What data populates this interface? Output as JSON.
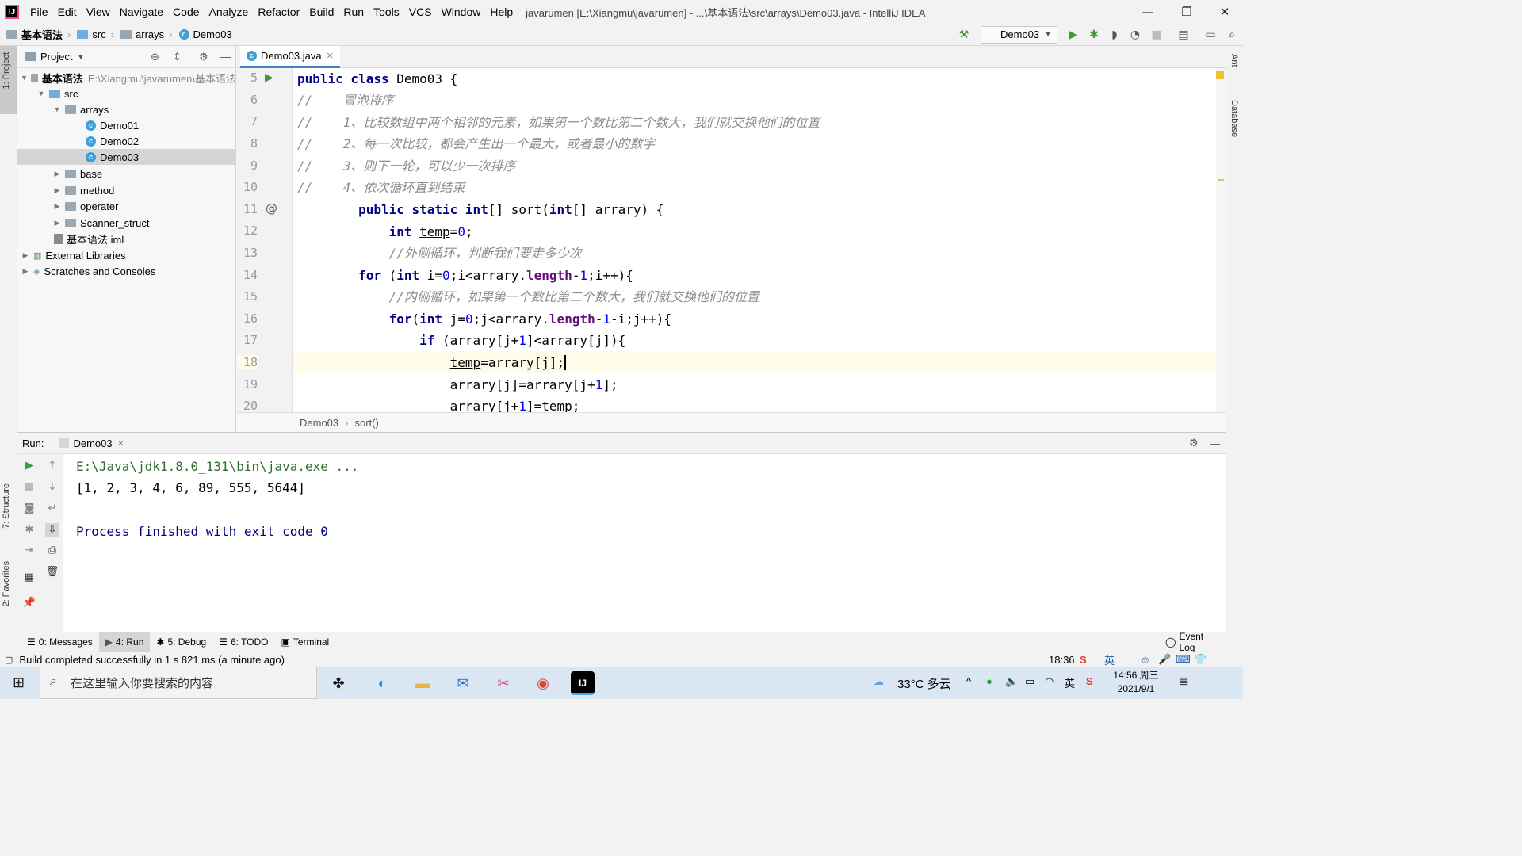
{
  "app": {
    "logo_text": "IJ",
    "menu": [
      "File",
      "Edit",
      "View",
      "Navigate",
      "Code",
      "Analyze",
      "Refactor",
      "Build",
      "Run",
      "Tools",
      "VCS",
      "Window",
      "Help"
    ],
    "window_title": "javarumen [E:\\Xiangmu\\javarumen] - ...\\基本语法\\src\\arrays\\Demo03.java - IntelliJ IDEA"
  },
  "nav": {
    "crumbs": [
      "基本语法",
      "src",
      "arrays",
      "Demo03"
    ],
    "run_config": "Demo03"
  },
  "project_panel": {
    "title": "Project",
    "side_tab": "1: Project",
    "tree": [
      {
        "label": "基本语法",
        "hint": "E:\\Xiangmu\\javarumen\\基本语法"
      },
      {
        "label": "src"
      },
      {
        "label": "arrays"
      },
      {
        "label": "Demo01"
      },
      {
        "label": "Demo02"
      },
      {
        "label": "Demo03"
      },
      {
        "label": "base"
      },
      {
        "label": "method"
      },
      {
        "label": "operater"
      },
      {
        "label": "Scanner_struct"
      },
      {
        "label": "基本语法.iml"
      },
      {
        "label": "External Libraries"
      },
      {
        "label": "Scratches and Consoles"
      }
    ]
  },
  "editor": {
    "tab": "Demo03.java",
    "line_numbers": [
      "5",
      "6",
      "7",
      "8",
      "9",
      "10",
      "11",
      "12",
      "13",
      "14",
      "15",
      "16",
      "17",
      "18",
      "19",
      "20"
    ],
    "breadcrumb": [
      "Demo03",
      "sort()"
    ]
  },
  "code_comments": {
    "l6": "//    冒泡排序",
    "l7": "//    1、比较数组中两个相邻的元素，如果第一个数比第二个数大，我们就交换他们的位置",
    "l8": "//    2、每一次比较，都会产生出一个最大，或者最小的数字",
    "l9": "//    3、则下一轮，可以少一次排序",
    "l10": "//    4、依次循环直到结束",
    "l13": "//外侧循环，判断我们要走多少次",
    "l15": "//内侧循环，如果第一个数比第二个数大，我们就交换他们的位置"
  },
  "run_panel": {
    "label": "Run:",
    "tab": "Demo03",
    "console": {
      "cmd": "E:\\Java\\jdk1.8.0_131\\bin\\java.exe ...",
      "output": "[1, 2, 3, 4, 6, 89, 555, 5644]",
      "finished": "Process finished with exit code 0"
    }
  },
  "bottom_tabs": [
    "0: Messages",
    "4: Run",
    "5: Debug",
    "6: TODO",
    "Terminal"
  ],
  "side_tabs": {
    "structure": "7: Structure",
    "favorites": "2: Favorites",
    "ant": "Ant",
    "database": "Database"
  },
  "status": {
    "message": "Build completed successfully in 1 s 821 ms (a minute ago)",
    "position": "18:36",
    "event_log": "Event Log"
  },
  "taskbar": {
    "search_placeholder": "在这里输入你要搜索的内容",
    "weather": "33°C 多云",
    "time": "14:56 周三",
    "date": "2021/9/1",
    "ime": "英"
  },
  "colors": {
    "keyword": "#000080",
    "number": "#0000ff",
    "comment": "#8c8c8c",
    "field": "#660e7a",
    "current_line": "#fefbe8",
    "accent": "#4083c9"
  }
}
